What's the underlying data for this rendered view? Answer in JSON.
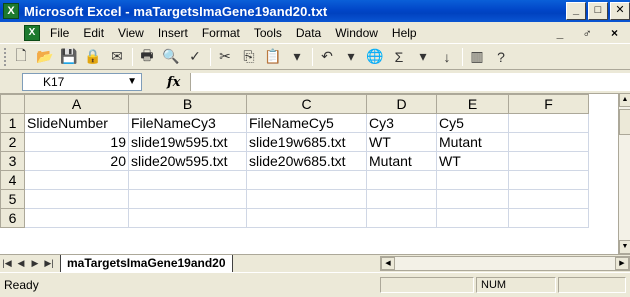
{
  "window": {
    "title": "Microsoft Excel - maTargetsImaGene19and20.txt",
    "min_label": "_",
    "max_label": "□",
    "close_label": "✕"
  },
  "menu": {
    "items": [
      "File",
      "Edit",
      "View",
      "Insert",
      "Format",
      "Tools",
      "Data",
      "Window",
      "Help"
    ],
    "right_controls": "_ ♂ ×"
  },
  "formula_bar": {
    "name_box": "K17",
    "fx_label": "fx",
    "formula": ""
  },
  "sheet": {
    "columns": [
      "A",
      "B",
      "C",
      "D",
      "E",
      "F"
    ],
    "rows": [
      {
        "num": "1",
        "cells": [
          "SlideNumber",
          "FileNameCy3",
          "FileNameCy5",
          "Cy3",
          "Cy5",
          ""
        ]
      },
      {
        "num": "2",
        "cells": [
          "19",
          "slide19w595.txt",
          "slide19w685.txt",
          "WT",
          "Mutant",
          ""
        ]
      },
      {
        "num": "3",
        "cells": [
          "20",
          "slide20w595.txt",
          "slide20w685.txt",
          "Mutant",
          "WT",
          ""
        ]
      },
      {
        "num": "4",
        "cells": [
          "",
          "",
          "",
          "",
          "",
          ""
        ]
      },
      {
        "num": "5",
        "cells": [
          "",
          "",
          "",
          "",
          "",
          ""
        ]
      },
      {
        "num": "6",
        "cells": [
          "",
          "",
          "",
          "",
          "",
          ""
        ]
      }
    ]
  },
  "tabs": {
    "active": "maTargetsImaGene19and20"
  },
  "status": {
    "left": "Ready",
    "num": "NUM"
  }
}
